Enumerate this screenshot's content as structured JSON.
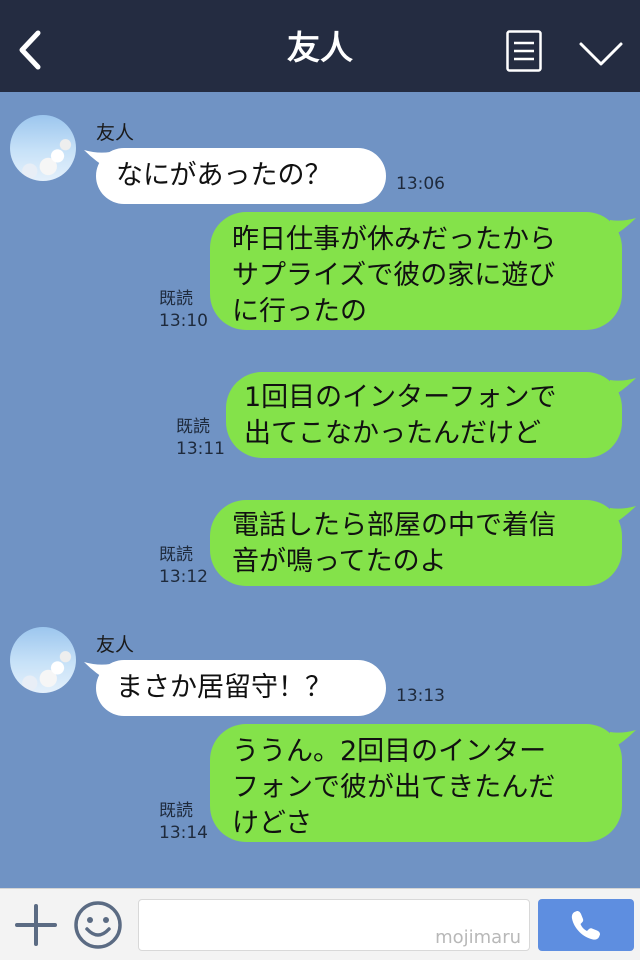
{
  "header": {
    "title": "友人"
  },
  "messages": [
    {
      "sender": "友人",
      "text": "なにがあったの？",
      "time": "13:06"
    },
    {
      "text": "昨日仕事が休みだったから\nサプライズで彼の家に遊び\nに行ったの",
      "read": "既読",
      "time": "13:10"
    },
    {
      "text": "1回目のインターフォンで\n出てこなかったんだけど",
      "read": "既読",
      "time": "13:11"
    },
    {
      "text": "電話したら部屋の中で着信\n音が鳴ってたのよ",
      "read": "既読",
      "time": "13:12"
    },
    {
      "sender": "友人",
      "text": "まさか居留守！？",
      "time": "13:13"
    },
    {
      "text": "ううん。2回目のインター\nフォンで彼が出てきたんだ\nけどさ",
      "read": "既読",
      "time": "13:14"
    }
  ],
  "footer": {
    "input_placeholder": "mojimaru"
  },
  "colors": {
    "header_bg": "#242c41",
    "chat_bg": "#7093c4",
    "incoming_bubble": "#ffffff",
    "outgoing_bubble": "#84e24a",
    "call_button": "#5e8ee0"
  },
  "icons": {
    "back": "chevron-left-icon",
    "menu": "menu-list-icon",
    "collapse": "chevron-down-icon",
    "plus": "plus-icon",
    "emoji": "smiley-icon",
    "call": "phone-icon"
  }
}
